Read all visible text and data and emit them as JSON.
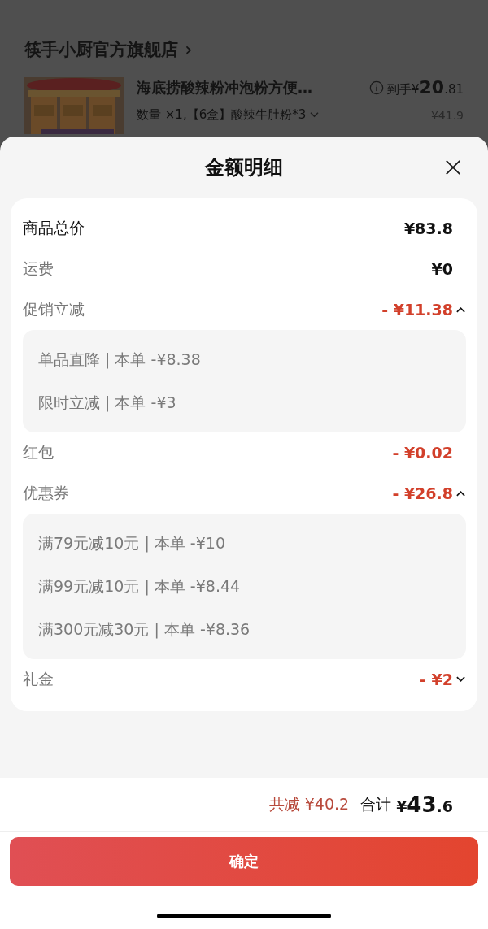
{
  "store": {
    "name": "筷手小厨官方旗舰店",
    "arrow": "›"
  },
  "product": {
    "kind": "picture",
    "title": "海底捞酸辣粉冲泡粉方便…",
    "price_prefix": "到手¥",
    "price_int": "20",
    "price_dec": ".81",
    "spec": "数量 ×1,【6盒】酸辣牛肚粉*3",
    "original_price": "¥41.9"
  },
  "sheet": {
    "title": "金额明细"
  },
  "rows": [
    {
      "kind": "total",
      "label": "商品总价",
      "value": "¥83.8"
    },
    {
      "kind": "fee",
      "label": "运费",
      "value": "¥0"
    },
    {
      "kind": "discount",
      "label": "促销立减",
      "value": "- ¥11.38",
      "expanded": true,
      "details": [
        "单品直降 | 本单 -¥8.38",
        "限时立减 | 本单 -¥3"
      ]
    },
    {
      "kind": "fee_discount",
      "label": "红包",
      "value": "- ¥0.02"
    },
    {
      "kind": "discount",
      "label": "优惠券",
      "value": "- ¥26.8",
      "expanded": true,
      "details": [
        "满79元减10元 | 本单 -¥10",
        "满99元减10元 | 本单 -¥8.44",
        "满300元减30元 | 本单 -¥8.36"
      ]
    },
    {
      "kind": "discount",
      "label": "礼金",
      "value": "- ¥2",
      "expanded": false
    }
  ],
  "summary": {
    "saved": "共减 ¥40.2",
    "total_label": "合计",
    "total_currency": "¥",
    "total_int": "43",
    "total_dec": ".6"
  },
  "confirm_button": "确定"
}
